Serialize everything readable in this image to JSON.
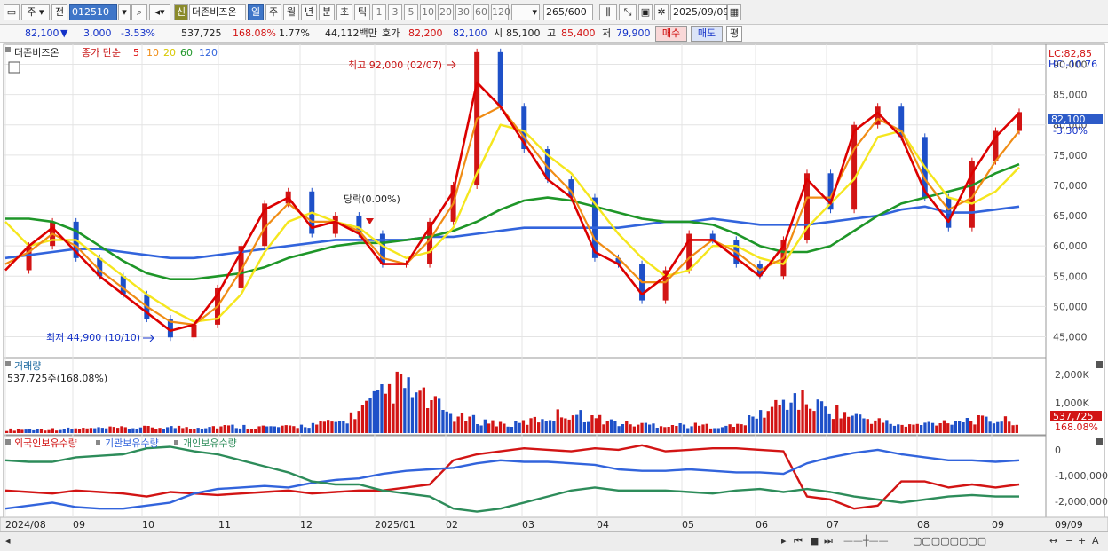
{
  "toolbar": {
    "market": "주",
    "jeon": "전",
    "code": "012510",
    "sin": "신",
    "name": "더존비즈온",
    "periods": [
      "일",
      "주",
      "월",
      "년",
      "분",
      "초",
      "틱"
    ],
    "active_period": "일",
    "minutes": [
      "1",
      "3",
      "5",
      "10",
      "20",
      "30",
      "60",
      "120"
    ],
    "count": "265",
    "total": "/600",
    "date": "2025/09/09"
  },
  "quote": {
    "price": "82,100",
    "arrow": "▼",
    "change": "3,000",
    "pct": "-3.53%",
    "volume": "537,725",
    "vol_ratio": "168.08%",
    "turnover_pct": "1.77%",
    "amount": "44,112백만",
    "hoga_label": "호가",
    "hoga1": "82,200",
    "hoga2": "82,100",
    "open_label": "시",
    "open": "85,100",
    "high_label": "고",
    "high": "85,400",
    "low_label": "저",
    "low": "79,900",
    "buy": "매수",
    "sell": "매도",
    "pyeong": "평"
  },
  "colors": {
    "up": "#d21414",
    "down": "#1e50c8",
    "ma5": "#dc0000",
    "ma10": "#f08c14",
    "ma20": "#f5e61e",
    "ma60": "#1e9628",
    "ma120": "#3264dc",
    "foreign": "#d21414",
    "institution": "#3264dc",
    "individual": "#2d8c5a",
    "grid": "#e4e4e4"
  },
  "price_panel": {
    "stock_tag": "더존비즈온",
    "legend_title": "종가 단순",
    "ma_labels": [
      "5",
      "10",
      "20",
      "60",
      "120"
    ],
    "lc": "LC:82,85",
    "hc": "HC:-10.76",
    "current_tag": "82,100",
    "current_pct": "-3.30%",
    "max_label": "최고 92,000 (02/07)",
    "min_label": "최저 44,900 (10/10)",
    "event_label": "당락(0.00%)"
  },
  "volume_panel": {
    "title": "거래량",
    "summary": "537,725주(168.08%)",
    "axis": [
      "2,000K",
      "1,000K"
    ],
    "tag": "537,725",
    "tag_pct": "168.08%"
  },
  "holdings_panel": {
    "legend": [
      "외국인보유수량",
      "기관보유수량",
      "개인보유수량"
    ],
    "axis": [
      "0",
      "-1,000,000",
      "-2,000,000"
    ]
  },
  "x_labels": [
    "2024/08",
    "09",
    "10",
    "11",
    "12",
    "2025/01",
    "02",
    "03",
    "04",
    "05",
    "06",
    "07",
    "08",
    "09"
  ],
  "x_corner": "09/09",
  "chart_data": {
    "type": "line",
    "y_axis_price": [
      "90,000",
      "85,000",
      "80,000",
      "75,000",
      "70,000",
      "65,000",
      "60,000",
      "55,000",
      "50,000",
      "45,000"
    ],
    "ylim_price": [
      42000,
      93000
    ],
    "price_anchors": [
      {
        "x": "2024/08",
        "close": 56000
      },
      {
        "x": "2024/08 mid",
        "close": 60000
      },
      {
        "x": "2024/08 late",
        "close": 64000
      },
      {
        "x": "09",
        "close": 58000
      },
      {
        "x": "09 mid",
        "close": 55000
      },
      {
        "x": "09 late",
        "close": 52000
      },
      {
        "x": "10",
        "close": 48000
      },
      {
        "x": "10/10",
        "close": 44900
      },
      {
        "x": "10 late",
        "close": 47000
      },
      {
        "x": "11",
        "close": 53000
      },
      {
        "x": "11 mid",
        "close": 60000
      },
      {
        "x": "11 late",
        "close": 67000
      },
      {
        "x": "12",
        "close": 69000
      },
      {
        "x": "12 mid",
        "close": 62000
      },
      {
        "x": "12 late",
        "close": 65000
      },
      {
        "x": "12 end",
        "close": 62000
      },
      {
        "x": "2025/01",
        "close": 57000
      },
      {
        "x": "01 mid",
        "close": 57000
      },
      {
        "x": "01 late",
        "close": 64000
      },
      {
        "x": "01 end",
        "close": 70000
      },
      {
        "x": "02/07",
        "close": 92000
      },
      {
        "x": "02 mid",
        "close": 83000
      },
      {
        "x": "02 late",
        "close": 76000
      },
      {
        "x": "03",
        "close": 71000
      },
      {
        "x": "03 mid",
        "close": 68000
      },
      {
        "x": "03 late",
        "close": 58000
      },
      {
        "x": "04",
        "close": 57000
      },
      {
        "x": "04 mid",
        "close": 51000
      },
      {
        "x": "04 late",
        "close": 56000
      },
      {
        "x": "05",
        "close": 62000
      },
      {
        "x": "05 mid",
        "close": 61000
      },
      {
        "x": "05 late",
        "close": 57000
      },
      {
        "x": "06",
        "close": 55000
      },
      {
        "x": "06 mid",
        "close": 61000
      },
      {
        "x": "06 late",
        "close": 72000
      },
      {
        "x": "07",
        "close": 66000
      },
      {
        "x": "07 mid",
        "close": 80000
      },
      {
        "x": "07 late",
        "close": 83000
      },
      {
        "x": "08",
        "close": 78000
      },
      {
        "x": "08 mid",
        "close": 68000
      },
      {
        "x": "08 late",
        "close": 63000
      },
      {
        "x": "09",
        "close": 74000
      },
      {
        "x": "09 mid",
        "close": 79000
      },
      {
        "x": "09/09",
        "close": 82100
      }
    ],
    "ma": [
      {
        "name": "5",
        "values": [
          56000,
          60000,
          63000,
          59000,
          55000,
          52000,
          49000,
          46000,
          47000,
          52000,
          59000,
          66000,
          68000,
          63000,
          64000,
          62000,
          57000,
          57000,
          63000,
          69000,
          87000,
          83000,
          77000,
          71000,
          68000,
          59000,
          57000,
          52000,
          55000,
          61000,
          61000,
          58000,
          55000,
          60000,
          71000,
          67000,
          79000,
          82000,
          78000,
          69000,
          64000,
          72000,
          78000,
          82000
        ]
      },
      {
        "name": "10",
        "values": [
          57000,
          59000,
          62000,
          60000,
          56000,
          53000,
          50000,
          47500,
          47000,
          50000,
          56000,
          63000,
          67000,
          64000,
          64000,
          62500,
          58000,
          57000,
          61000,
          67000,
          81000,
          83000,
          78000,
          73000,
          69000,
          61000,
          58000,
          54000,
          54000,
          58000,
          61000,
          59000,
          56000,
          58000,
          68000,
          68000,
          76000,
          81000,
          79000,
          71000,
          66000,
          68000,
          74000,
          79000
        ]
      },
      {
        "name": "20",
        "values": [
          64000,
          60000,
          61000,
          61000,
          58000,
          55000,
          52000,
          49500,
          47500,
          48000,
          52000,
          59000,
          64000,
          65500,
          64000,
          63000,
          60000,
          58000,
          59000,
          63000,
          72000,
          80000,
          79000,
          75000,
          72000,
          67000,
          62000,
          58000,
          55000,
          56000,
          60000,
          60000,
          58000,
          57000,
          63000,
          67000,
          71000,
          78000,
          79000,
          73000,
          68000,
          67000,
          69000,
          73000
        ]
      },
      {
        "name": "60",
        "values": [
          64500,
          64500,
          64000,
          62500,
          60000,
          57500,
          55500,
          54500,
          54500,
          55000,
          55500,
          56500,
          58000,
          59000,
          60000,
          60500,
          60500,
          61000,
          61500,
          62500,
          64000,
          66000,
          67500,
          68000,
          67500,
          66500,
          65500,
          64500,
          64000,
          64000,
          63500,
          62000,
          60000,
          59000,
          59000,
          60000,
          62500,
          65000,
          67000,
          68000,
          69000,
          70000,
          72000,
          73500
        ]
      },
      {
        "name": "120",
        "values": [
          58000,
          58500,
          59000,
          59500,
          59500,
          59000,
          58500,
          58000,
          58000,
          58500,
          59000,
          59500,
          60000,
          60500,
          61000,
          61000,
          61000,
          61000,
          61500,
          61500,
          62000,
          62500,
          63000,
          63000,
          63000,
          63000,
          63000,
          63500,
          64000,
          64000,
          64500,
          64000,
          63500,
          63500,
          63500,
          64000,
          64500,
          65000,
          66000,
          66500,
          65500,
          65500,
          66000,
          66500
        ]
      }
    ],
    "volume_ylim": [
      0,
      2300000
    ],
    "volume_key": [
      {
        "x": "2024/08",
        "v": 150000
      },
      {
        "x": "09",
        "v": 180000
      },
      {
        "x": "10",
        "v": 220000
      },
      {
        "x": "11",
        "v": 260000
      },
      {
        "x": "12",
        "v": 300000
      },
      {
        "x": "2025/01",
        "v": 260000
      },
      {
        "x": "01 late",
        "v": 520000
      },
      {
        "x": "02/07",
        "v": 2150000
      },
      {
        "x": "02 mid",
        "v": 700000
      },
      {
        "x": "03",
        "v": 350000
      },
      {
        "x": "03 late",
        "v": 900000
      },
      {
        "x": "04",
        "v": 400000
      },
      {
        "x": "05",
        "v": 350000
      },
      {
        "x": "06",
        "v": 300000
      },
      {
        "x": "06 late",
        "v": 1550000
      },
      {
        "x": "07",
        "v": 800000
      },
      {
        "x": "08",
        "v": 300000
      },
      {
        "x": "09",
        "v": 600000
      },
      {
        "x": "09/09",
        "v": 537725
      }
    ],
    "holdings_ylim": [
      -2300000,
      200000
    ],
    "holdings": [
      {
        "name": "외국인보유수량",
        "values": [
          -1500000,
          -1550000,
          -1600000,
          -1500000,
          -1550000,
          -1600000,
          -1700000,
          -1550000,
          -1600000,
          -1650000,
          -1600000,
          -1550000,
          -1500000,
          -1600000,
          -1550000,
          -1500000,
          -1500000,
          -1400000,
          -1300000,
          -500000,
          -300000,
          -200000,
          -100000,
          -150000,
          -200000,
          -100000,
          -150000,
          0,
          -200000,
          -150000,
          -100000,
          -100000,
          -150000,
          -200000,
          -1700000,
          -1800000,
          -2100000,
          -2000000,
          -1200000,
          -1200000,
          -1400000,
          -1300000,
          -1400000,
          -1300000
        ]
      },
      {
        "name": "기관보유수량",
        "values": [
          -2100000,
          -2000000,
          -1900000,
          -2050000,
          -2100000,
          -2100000,
          -2000000,
          -1900000,
          -1600000,
          -1450000,
          -1400000,
          -1350000,
          -1400000,
          -1250000,
          -1150000,
          -1100000,
          -950000,
          -850000,
          -800000,
          -750000,
          -600000,
          -500000,
          -550000,
          -550000,
          -600000,
          -650000,
          -800000,
          -850000,
          -850000,
          -800000,
          -850000,
          -900000,
          -900000,
          -950000,
          -600000,
          -400000,
          -250000,
          -150000,
          -300000,
          -400000,
          -500000,
          -500000,
          -550000,
          -500000
        ]
      },
      {
        "name": "개인보유수량",
        "values": [
          -500000,
          -550000,
          -550000,
          -400000,
          -350000,
          -300000,
          -100000,
          -50000,
          -200000,
          -300000,
          -500000,
          -700000,
          -900000,
          -1200000,
          -1300000,
          -1300000,
          -1500000,
          -1600000,
          -1700000,
          -2100000,
          -2200000,
          -2100000,
          -1900000,
          -1700000,
          -1500000,
          -1400000,
          -1500000,
          -1500000,
          -1500000,
          -1550000,
          -1600000,
          -1500000,
          -1450000,
          -1550000,
          -1450000,
          -1550000,
          -1700000,
          -1800000,
          -1900000,
          -1800000,
          -1700000,
          -1650000,
          -1700000,
          -1700000
        ]
      }
    ]
  }
}
